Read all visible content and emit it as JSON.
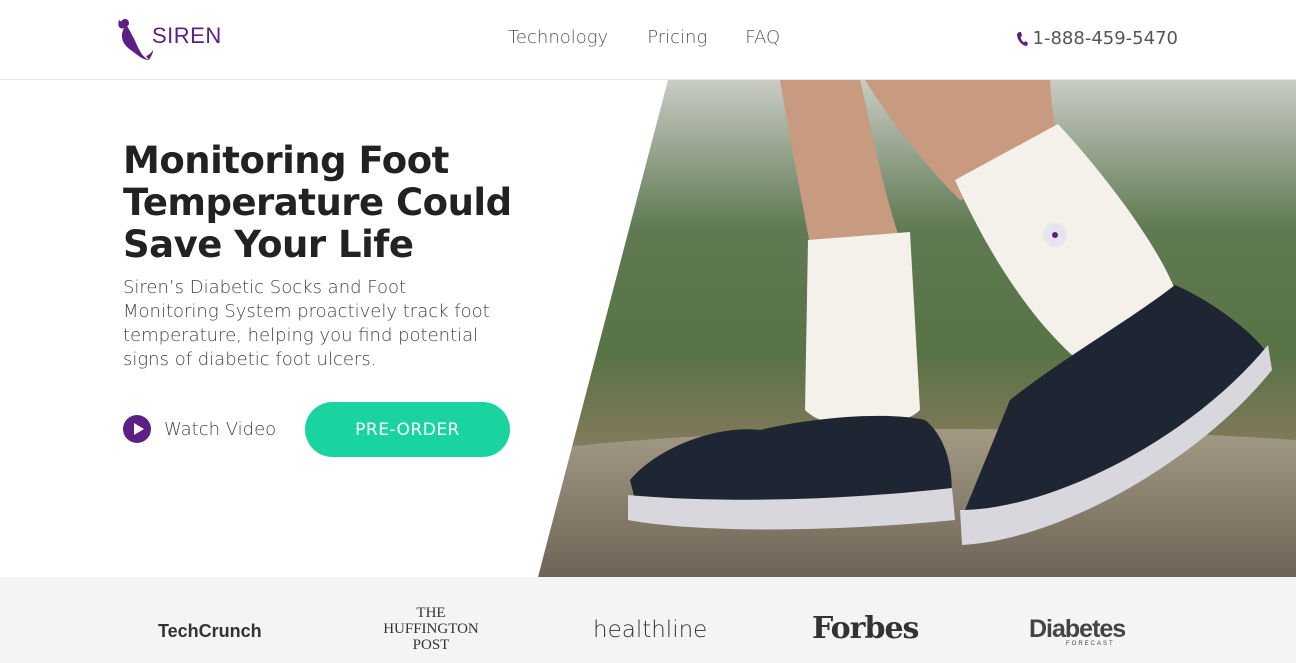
{
  "brand": {
    "name": "SIREN",
    "color": "#5c1f83"
  },
  "nav": {
    "items": [
      {
        "label": "Technology"
      },
      {
        "label": "Pricing"
      },
      {
        "label": "FAQ"
      }
    ]
  },
  "phone": {
    "number": "1-888-459-5470",
    "icon": "phone-icon"
  },
  "hero": {
    "headline": "Monitoring Foot Temperature Could Save Your Life",
    "subtext": "Siren’s Diabetic Socks and Foot Monitoring System proactively track foot temperature, helping you find potential signs of diabetic foot ulcers.",
    "watch_video_label": "Watch Video",
    "preorder_label": "PRE-ORDER",
    "accent_color": "#19d4a0",
    "image": "Person walking outdoors wearing white sensor socks and dark sneakers"
  },
  "press": {
    "logos": [
      {
        "name": "TechCrunch",
        "text": "TechCrunch"
      },
      {
        "name": "The Huffington Post",
        "lines": [
          "THE",
          "HUFFINGTON",
          "POST"
        ]
      },
      {
        "name": "Healthline",
        "text": "healthline"
      },
      {
        "name": "Forbes",
        "text": "Forbes"
      },
      {
        "name": "Diabetes Forecast",
        "text": "Diabetes",
        "subtext": "FORECAST"
      }
    ]
  }
}
